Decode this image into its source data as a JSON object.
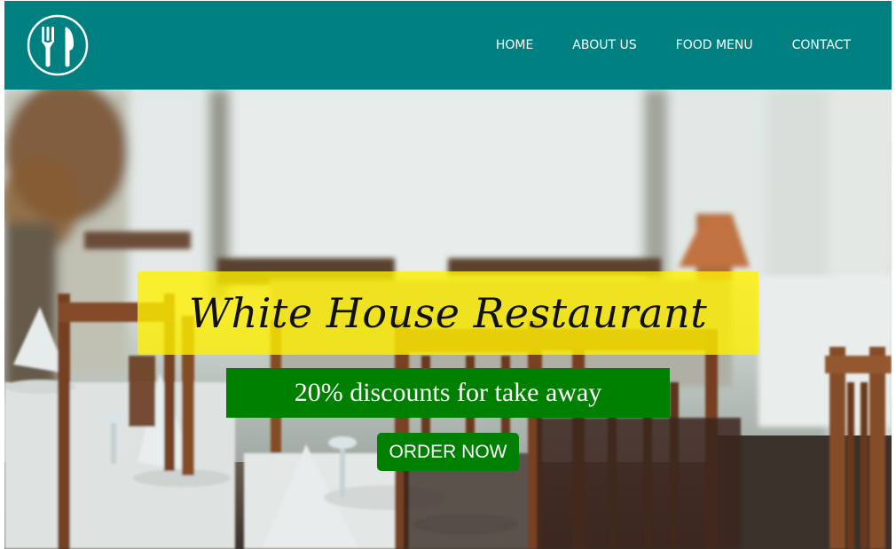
{
  "navbar": {
    "logo_icon": "fork-knife-icon",
    "links": [
      "HOME",
      "ABOUT US",
      "FOOD MENU",
      "CONTACT"
    ],
    "background": "#008080"
  },
  "hero": {
    "background_image": "restaurant-dining-room-photo",
    "title": "White House Restaurant",
    "title_background": "#FFF000",
    "discount": "20% discounts for take away",
    "discount_background": "#008000",
    "order_button": "ORDER NOW",
    "order_button_background": "#008000"
  }
}
